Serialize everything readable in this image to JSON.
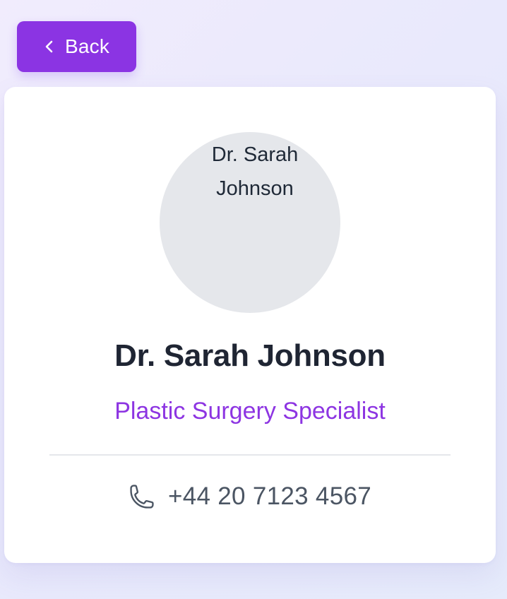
{
  "back_button": {
    "label": "Back",
    "icon": "chevron-left-icon"
  },
  "profile": {
    "avatar_alt": "Dr. Sarah Johnson",
    "name": "Dr. Sarah Johnson",
    "specialty": "Plastic Surgery Specialist",
    "phone": "+44 20 7123 4567",
    "phone_icon": "phone-icon"
  },
  "colors": {
    "accent": "#8b34e3",
    "specialty_text": "#8d35e2",
    "name_text": "#1f2533",
    "muted_text": "#4b5563",
    "avatar_placeholder": "#e5e7eb",
    "background_start": "#f1ecfd",
    "background_end": "#e6ebfb"
  }
}
